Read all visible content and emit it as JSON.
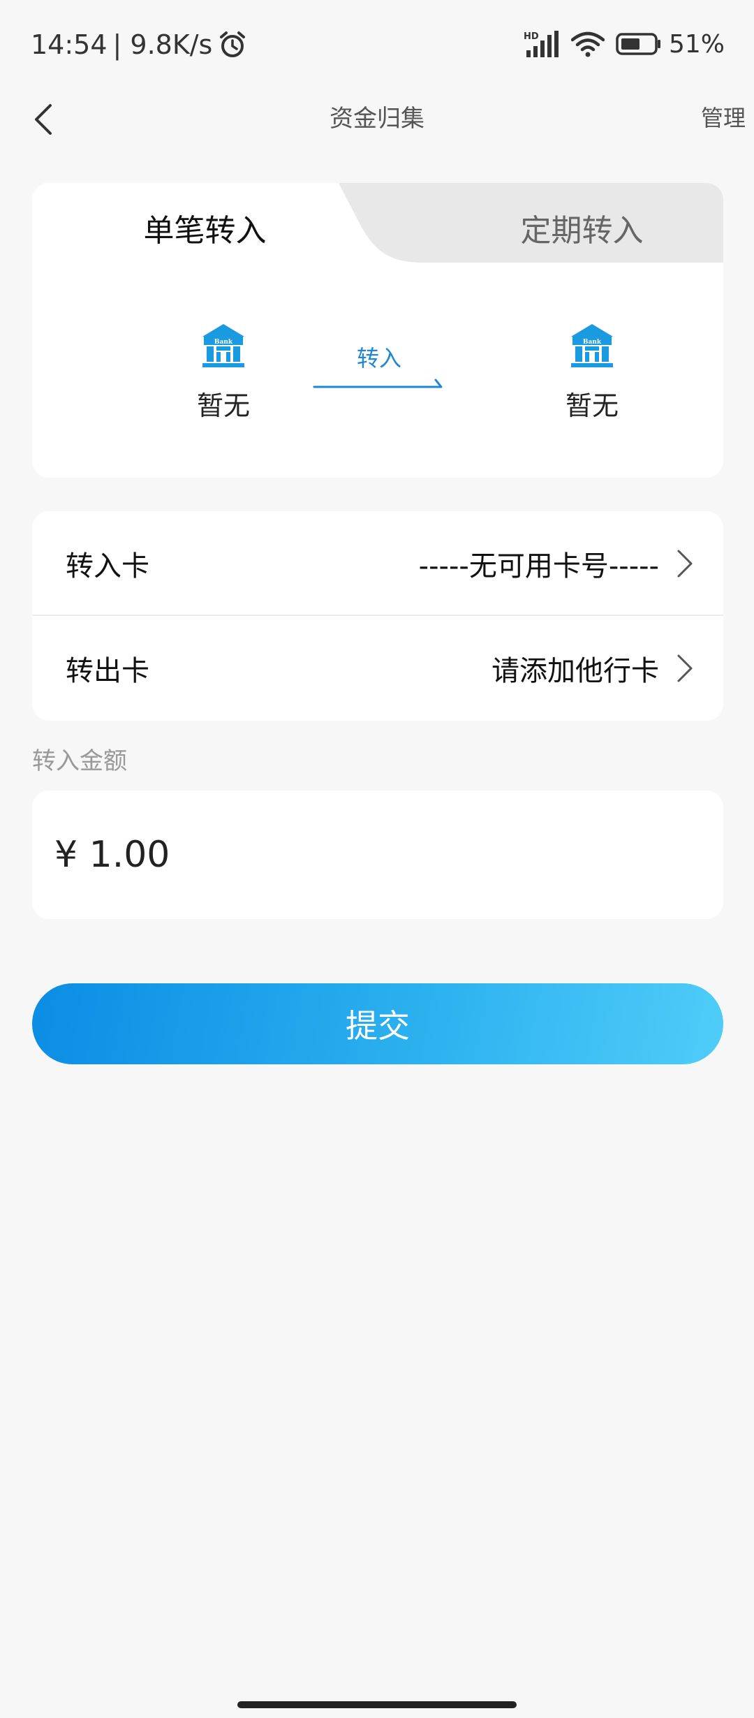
{
  "status_bar": {
    "time": "14:54",
    "net_speed": "| 9.8K/s",
    "network_label": "HD",
    "battery": "51%",
    "icons": [
      "alarm-icon",
      "signal-icon",
      "wifi-icon",
      "battery-icon"
    ]
  },
  "nav": {
    "title": "资金归集",
    "manage": "管理",
    "back_icon": "chevron-left-icon"
  },
  "tabs": {
    "single": "单笔转入",
    "scheduled": "定期转入",
    "active": "single"
  },
  "transfer": {
    "from_bank": "暂无",
    "to_bank": "暂无",
    "arrow_label": "转入",
    "bank_icon_text": "Bank"
  },
  "cards": {
    "in_label": "转入卡",
    "in_value": "-----无可用卡号-----",
    "out_label": "转出卡",
    "out_value": "请添加他行卡"
  },
  "amount": {
    "label": "转入金额",
    "value": "¥ 1.00"
  },
  "submit": "提交",
  "colors": {
    "accent": "#1e88d6",
    "button_start": "#0b8de4",
    "button_end": "#4fcdf9",
    "bank_icon": "#1a9be0",
    "background": "#f7f7f7"
  }
}
